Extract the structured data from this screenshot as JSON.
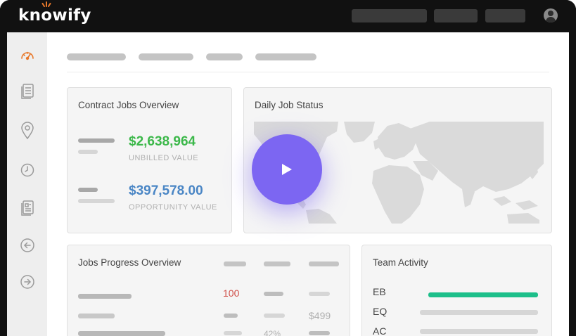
{
  "app": {
    "logo_text_pre": "kn",
    "logo_text_o": "o",
    "logo_text_post": "wify",
    "accent_color": "#e8782a"
  },
  "sidebar": {
    "items": [
      {
        "name": "dashboard-icon",
        "active": true
      },
      {
        "name": "documents-icon",
        "active": false
      },
      {
        "name": "location-pin-icon",
        "active": false
      },
      {
        "name": "clock-icon",
        "active": false
      },
      {
        "name": "report-icon",
        "active": false
      },
      {
        "name": "arrow-left-circle-icon",
        "active": false
      },
      {
        "name": "arrow-right-circle-icon",
        "active": false
      }
    ]
  },
  "contract_jobs": {
    "title": "Contract Jobs Overview",
    "unbilled_value": "$2,638,964",
    "unbilled_label": "UNBILLED VALUE",
    "unbilled_color": "#3cb84a",
    "opportunity_value": "$397,578.00",
    "opportunity_label": "OPPORTUNITY VALUE",
    "opportunity_color": "#4a86c5"
  },
  "daily_status": {
    "title": "Daily Job Status",
    "play_color": "#7c66f2"
  },
  "jobs_progress": {
    "title": "Jobs Progress Overview",
    "value_row1": "100",
    "value_row1_color": "#d0504a",
    "value_row2": "$499",
    "value_row3": "42%"
  },
  "team_activity": {
    "title": "Team Activity",
    "members": [
      {
        "initials": "EB",
        "active": true
      },
      {
        "initials": "EQ",
        "active": false
      },
      {
        "initials": "AC",
        "active": false
      }
    ],
    "active_color": "#1dbf8a"
  }
}
